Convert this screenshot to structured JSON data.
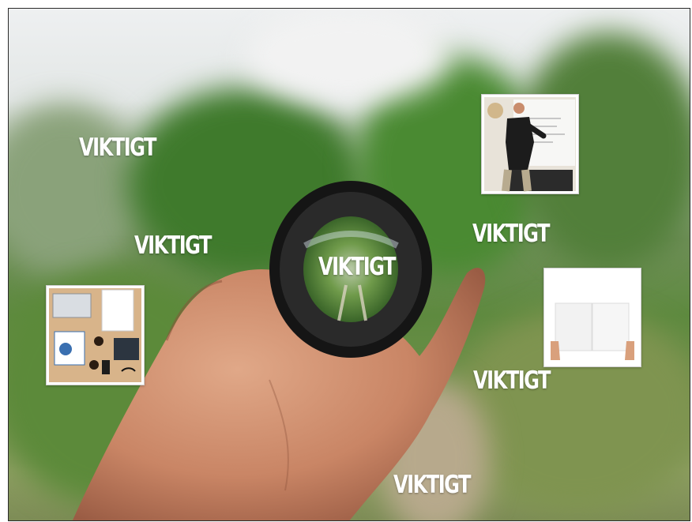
{
  "labels": {
    "w1": "VIKTIGT",
    "w2": "VIKTIGT",
    "w3": "VIKTIGT",
    "w4": "VIKTIGT",
    "w5": "VIKTIGT",
    "w6": "VIKTIGT"
  },
  "colors": {
    "text": "#ffffff",
    "frame": "#2a2a2a"
  }
}
